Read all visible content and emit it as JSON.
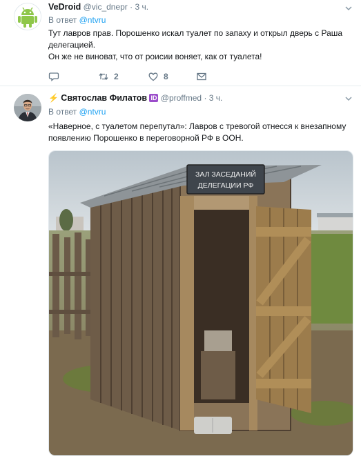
{
  "tweets": [
    {
      "name": "VeDroid",
      "handle": "@vic_dnepr",
      "dot": "·",
      "time": "3 ч.",
      "reply_prefix": "В ответ",
      "reply_handle": "@ntvru",
      "text_lines": [
        "Тут лавров прав. Порошенко искал туалет по запаху и открыл дверь с Раша делегацией.",
        "Он же не виноват, что от роисии воняет, как от туалета!"
      ],
      "actions": {
        "reply_count": "",
        "retweet_count": "2",
        "like_count": "8"
      }
    },
    {
      "bolt": "⚡",
      "name": "Святослав Филатов",
      "badge": "ID",
      "handle": "@proffmed",
      "dot": "·",
      "time": "3 ч.",
      "reply_prefix": "В ответ",
      "reply_handle": "@ntvru",
      "text": "«Наверное, с туалетом перепутал»: Лавров с тревогой отнесся к внезапному появлению Порошенко в переговорной РФ в ООН.",
      "media": {
        "sign_line1": "ЗАЛ ЗАСЕДАНИЙ",
        "sign_line2": "ДЕЛЕГАЦИИ РФ"
      }
    }
  ],
  "colors": {
    "link": "#1da1f2",
    "muted": "#657786",
    "text": "#14171a",
    "divider": "#e6ecf0"
  },
  "icons": [
    "android-avatar",
    "user-avatar",
    "chevron-down-icon",
    "reply-icon",
    "retweet-icon",
    "like-icon",
    "message-icon"
  ]
}
